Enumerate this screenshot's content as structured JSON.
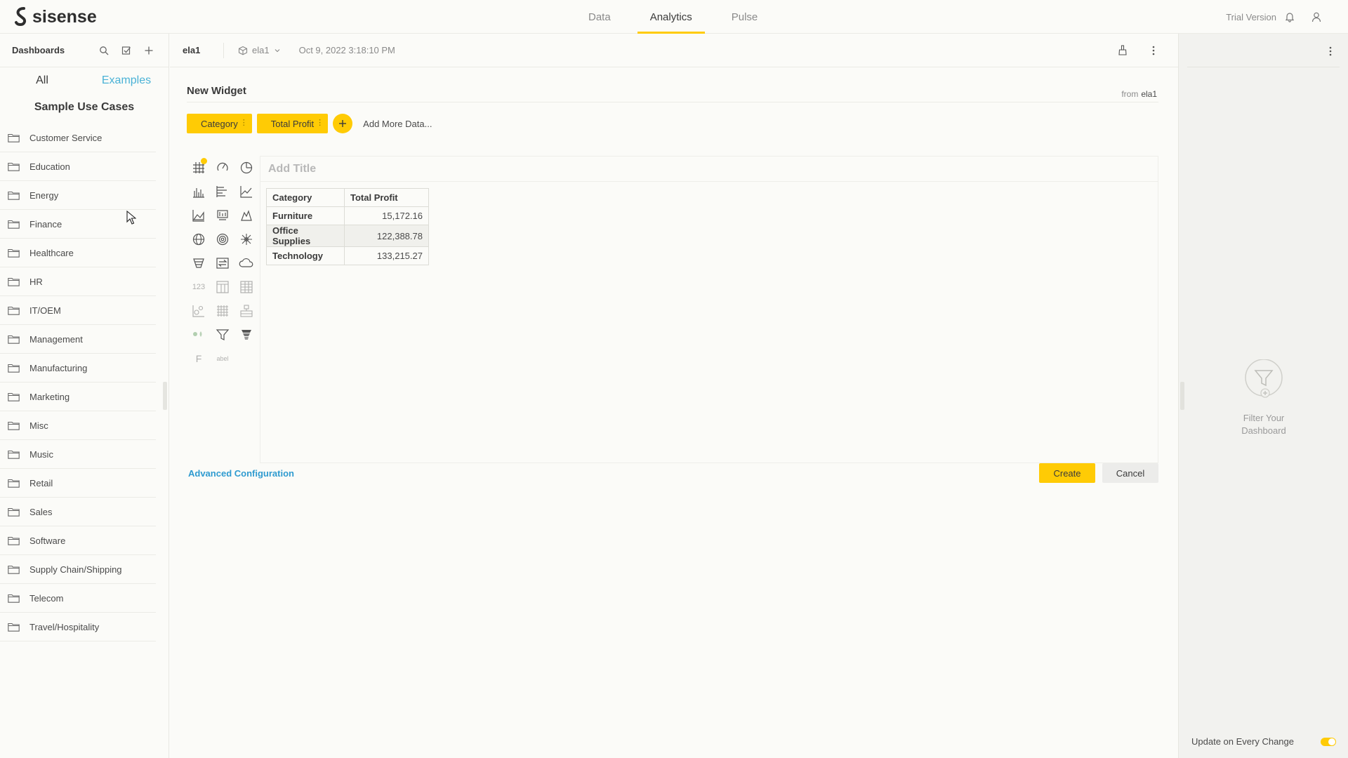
{
  "app": {
    "brand": "sisense",
    "nav": [
      {
        "label": "Data",
        "active": false
      },
      {
        "label": "Analytics",
        "active": true
      },
      {
        "label": "Pulse",
        "active": false
      }
    ],
    "trial_label": "Trial Version"
  },
  "sidebar": {
    "title": "Dashboards",
    "tabs": {
      "all": "All",
      "examples": "Examples"
    },
    "section_title": "Sample Use Cases",
    "folders": [
      "Customer Service",
      "Education",
      "Energy",
      "Finance",
      "Healthcare",
      "HR",
      "IT/OEM",
      "Management",
      "Manufacturing",
      "Marketing",
      "Misc",
      "Music",
      "Retail",
      "Sales",
      "Software",
      "Supply Chain/Shipping",
      "Telecom",
      "Travel/Hospitality"
    ]
  },
  "dashboard_bar": {
    "name": "ela1",
    "datasource": "ela1",
    "date": "Oct 9, 2022 3:18:10 PM"
  },
  "widget_editor": {
    "title": "New Widget",
    "from_label": "from",
    "from_source": "ela1",
    "chips": [
      "Category",
      "Total Profit"
    ],
    "add_more_label": "Add More Data...",
    "gallery_text_labels": {
      "indicator": "123",
      "formula": "F",
      "label": "abel"
    },
    "preview": {
      "title_placeholder": "Add Title",
      "table": {
        "headers": [
          "Category",
          "Total Profit"
        ],
        "rows": [
          {
            "category": "Furniture",
            "value": "15,172.16"
          },
          {
            "category": "Office Supplies",
            "value": "122,388.78"
          },
          {
            "category": "Technology",
            "value": "133,215.27"
          }
        ]
      }
    },
    "advanced_label": "Advanced Configuration",
    "create_label": "Create",
    "cancel_label": "Cancel"
  },
  "filter_panel": {
    "empty_text": "Filter Your Dashboard",
    "footer_label": "Update on Every Change",
    "update_on_change": true
  },
  "colors": {
    "accent": "#ffcb05",
    "link": "#2f9bd0",
    "tab_accent": "#4ab2d6"
  }
}
